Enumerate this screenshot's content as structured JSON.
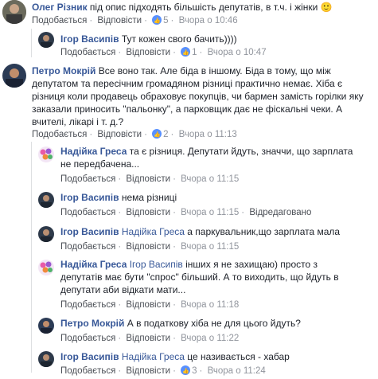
{
  "comments": [
    {
      "author": "Олег Різник",
      "text": " під опис підходять більшість депутатів, в т.ч. і жінки",
      "emoji": "🙂",
      "like": "Подобається",
      "reply": "Відповісти",
      "likes": "5",
      "time": "Вчора о 10:46"
    },
    {
      "author": "Ігор Васипів",
      "text": " Тут кожен свого бачить))))",
      "like": "Подобається",
      "reply": "Відповісти",
      "likes": "1",
      "time": "Вчора о 10:47"
    },
    {
      "author": "Петро Мокрій",
      "text_lines": [
        " Все воно так. Але біда в іншому. Біда в тому, що між",
        "депутатом та пересічним громадяном різниці практично немає. Хіба є",
        "різниця коли продавець обраховує покупців, чи бармен замість горілки яку",
        "заказали приносить \"пальонку\", а парковщик дає не фіскальні чеки. А",
        "вчителі, лікарі і т. д.?"
      ],
      "like": "Подобається",
      "reply": "Відповісти",
      "likes": "2",
      "time": "Вчора о 11:13"
    },
    {
      "author": "Надійка Греса",
      "text_lines": [
        " та є різниця. Депутати йдуть, значчи, що зарплата",
        "не передбачена..."
      ],
      "like": "Подобається",
      "reply": "Відповісти",
      "time": "Вчора о 11:15"
    },
    {
      "author": "Ігор Васипів",
      "text": " нема різниці",
      "like": "Подобається",
      "reply": "Відповісти",
      "time": "Вчора о 11:15",
      "edited": "Відредаговано"
    },
    {
      "author": "Ігор Васипів",
      "mention": "Надійка Греса",
      "text": " а паркувальник,що зарплата мала",
      "like": "Подобається",
      "reply": "Відповісти",
      "time": "Вчора о 11:15"
    },
    {
      "author": "Надійка Греса",
      "mention": "Ігор Васипів",
      "text_lines": [
        " інших я не захищаю) просто з",
        "депутатів має бути \"спрос\" більший. А то виходить, що йдуть в",
        "депутати аби відкати мати..."
      ],
      "like": "Подобається",
      "reply": "Відповісти",
      "time": "Вчора о 11:18"
    },
    {
      "author": "Петро Мокрій",
      "text": " А в податкову хіба не для цього йдуть?",
      "like": "Подобається",
      "reply": "Відповісти",
      "time": "Вчора о 11:22"
    },
    {
      "author": "Ігор Васипів",
      "mention": "Надійка Греса",
      "text": " це називається - хабар",
      "like": "Подобається",
      "reply": "Відповісти",
      "likes": "3",
      "time": "Вчора о 11:24"
    }
  ],
  "colors": {
    "link": "#385898",
    "meta": "#90949c",
    "badge": "#5890ff"
  },
  "separator": "·"
}
